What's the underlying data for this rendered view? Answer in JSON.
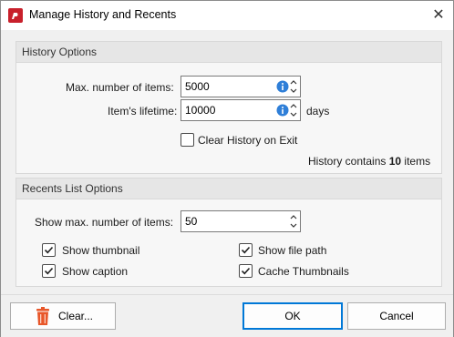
{
  "window": {
    "title": "Manage History and Recents"
  },
  "history": {
    "header": "History Options",
    "max_items_label": "Max. number of items:",
    "max_items_value": "5000",
    "lifetime_label": "Item's lifetime:",
    "lifetime_value": "10000",
    "days_label": "days",
    "clear_on_exit_label": "Clear History on Exit",
    "clear_on_exit_checked": false,
    "contains_prefix": "History contains",
    "contains_count": "10",
    "contains_suffix": "items"
  },
  "recents": {
    "header": "Recents List Options",
    "max_items_label": "Show max. number of items:",
    "max_items_value": "50",
    "show_thumbnail": {
      "label": "Show thumbnail",
      "checked": true
    },
    "show_caption": {
      "label": "Show caption",
      "checked": true
    },
    "show_file_path": {
      "label": "Show file path",
      "checked": true
    },
    "cache_thumbnails": {
      "label": "Cache Thumbnails",
      "checked": true
    }
  },
  "buttons": {
    "clear": "Clear...",
    "ok": "OK",
    "cancel": "Cancel"
  },
  "colors": {
    "accent": "#0078d7",
    "trash": "#e8572a",
    "info": "#2f7fd8",
    "brand_red": "#c8202b"
  },
  "icons": {
    "app": "pdf-app-icon",
    "close": "close-icon",
    "info": "info-icon",
    "trash": "trash-icon"
  }
}
